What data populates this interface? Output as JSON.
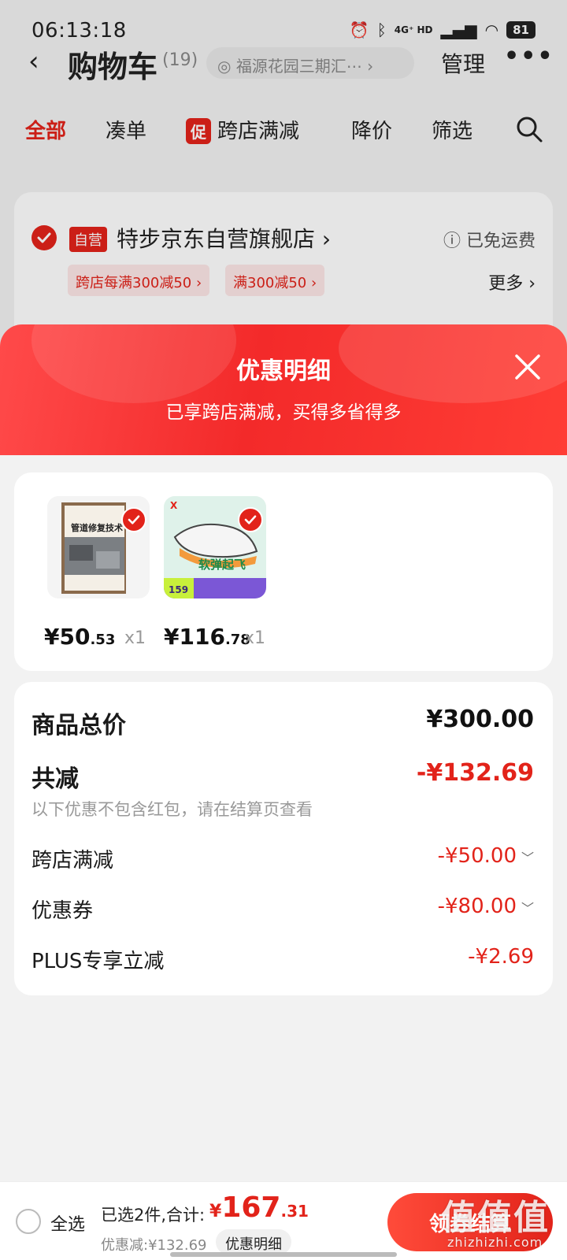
{
  "status_bar": {
    "time": "06:13:18",
    "network": "4G⁺ HD",
    "battery": "81"
  },
  "cart_header": {
    "title": "购物车",
    "count": "(19)",
    "address": "福源花园三期汇⋯ ›",
    "manage": "管理",
    "more": "•••"
  },
  "filter_tabs": {
    "all": "全部",
    "bundle": "凑单",
    "promo_badge": "促",
    "cross_store": "跨店满减",
    "price_drop": "降价",
    "filter": "筛选"
  },
  "shop": {
    "self_operated_tag": "自营",
    "name": "特步京东自营旗舰店 ›",
    "free_shipping": "ⓘ 已免运费",
    "coupons": [
      "跨店每满300减50 ›",
      "满300减50 ›"
    ],
    "more": "更多 ›"
  },
  "sheet": {
    "title": "优惠明细",
    "subtitle": "已享跨店满减，买得多省得多",
    "products": [
      {
        "currency": "¥",
        "price_int": "50",
        "price_dec": ".53",
        "qty": "x1",
        "thumb_text": "管道修复技术"
      },
      {
        "currency": "¥",
        "price_int": "116",
        "price_dec": ".78",
        "qty": "x1",
        "thumb_text": "软弹起飞",
        "thumb_price": "159"
      }
    ],
    "summary": {
      "total_label": "商品总价",
      "total_value": "¥300.00",
      "reduce_label": "共减",
      "reduce_value": "-¥132.69",
      "reduce_note": "以下优惠不包含红包，请在结算页查看",
      "lines": [
        {
          "label": "跨店满减",
          "value": "-¥50.00",
          "expandable": true
        },
        {
          "label": "优惠券",
          "value": "-¥80.00",
          "expandable": true
        },
        {
          "label": "PLUS专享立减",
          "value": "-¥2.69",
          "expandable": false
        }
      ]
    }
  },
  "bottom_bar": {
    "select_all": "全选",
    "selected_summary": "已选2件,合计:",
    "total_currency": "¥",
    "total_int": "167",
    "total_dec": ".31",
    "discount": "优惠减:¥132.69",
    "detail_button": "优惠明细",
    "checkout_button": "领券结算"
  },
  "watermark": {
    "text": "值值值",
    "sub": "zhizhizhi.com"
  },
  "colors": {
    "accent": "#e2231a",
    "sheet_header": "#f32a2a"
  }
}
